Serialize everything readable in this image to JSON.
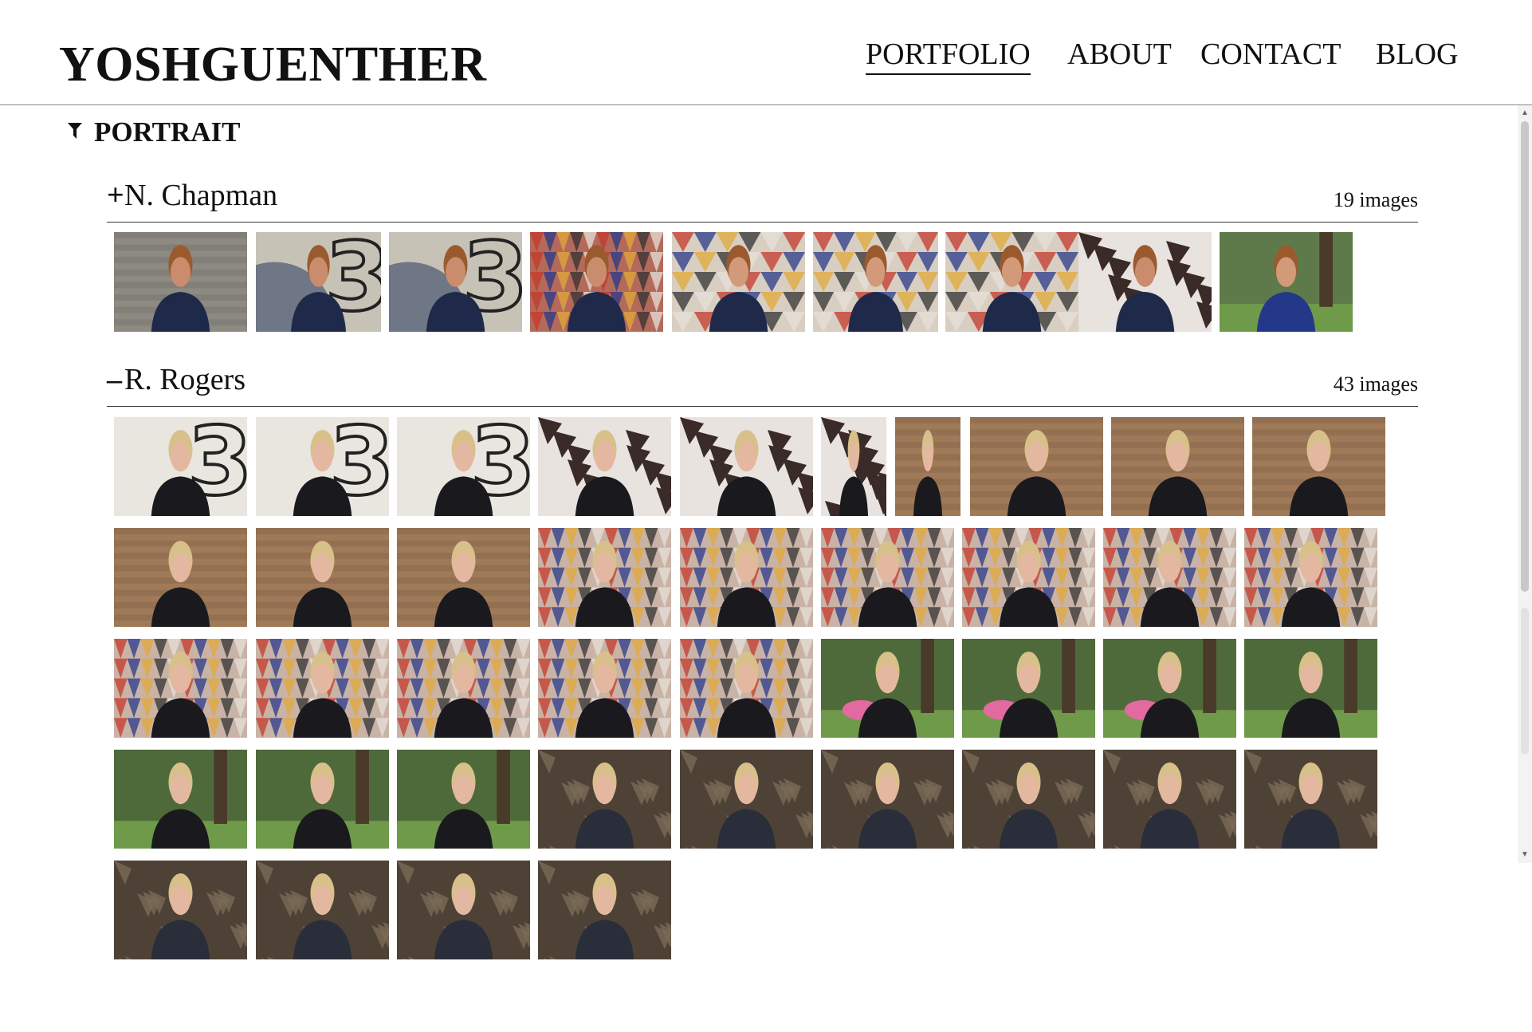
{
  "site": {
    "logo": "YOSHGUENTHER"
  },
  "nav": [
    {
      "label": "PORTFOLIO",
      "active": true
    },
    {
      "label": "ABOUT",
      "active": false
    },
    {
      "label": "CONTACT",
      "active": false
    },
    {
      "label": "BLOG",
      "active": false
    }
  ],
  "category": {
    "label": "PORTRAIT",
    "icon": "funnel-icon"
  },
  "albums": [
    {
      "toggle": "+",
      "name": "N. Chapman",
      "count": "19 images",
      "thumbs": [
        {
          "bg": "#8d8a82",
          "fig": "#1f2a4a",
          "skin": "#c98d6e",
          "hair": "#9a5a2e",
          "pat": "wood"
        },
        {
          "bg": "#c7c2b6",
          "fig": "#1f2a4a",
          "skin": "#c98d6e",
          "hair": "#9a5a2e",
          "pat": "num"
        },
        {
          "bg": "#c7c2b6",
          "fig": "#1f2a4a",
          "skin": "#c98d6e",
          "hair": "#9a5a2e",
          "pat": "num"
        },
        {
          "bg": "#b46a5a",
          "fig": "#1f2a4a",
          "skin": "#c98d6e",
          "hair": "#9a5a2e",
          "pat": "tri"
        },
        {
          "bg": "#d8cfc2",
          "fig": "#1f2a4a",
          "skin": "#d29a78",
          "hair": "#9a5a2e",
          "pat": "tri2"
        },
        {
          "bg": "#d8cfc2",
          "fig": "#1f2a4a",
          "skin": "#d29a78",
          "hair": "#9a5a2e",
          "pat": "tri2"
        },
        {
          "bg": "#d8cfc2",
          "fig": "#1f2a4a",
          "skin": "#d29a78",
          "hair": "#9a5a2e",
          "pat": "tri2"
        },
        {
          "bg": "#e8e3de",
          "fig": "#1f2a4a",
          "skin": "#c98d6e",
          "hair": "#9a5a2e",
          "pat": "geo"
        },
        {
          "bg": "#5f7a4a",
          "fig": "#24388a",
          "skin": "#d29a78",
          "hair": "#9a5a2e",
          "pat": "park"
        }
      ]
    },
    {
      "toggle": "–",
      "name": "R. Rogers",
      "count": "43 images",
      "thumbs": [
        {
          "bg": "#e9e6e0",
          "fig": "#1a1a1e",
          "skin": "#e4b8a0",
          "hair": "#d8c08a",
          "pat": "num3"
        },
        {
          "bg": "#e9e6e0",
          "fig": "#1a1a1e",
          "skin": "#e4b8a0",
          "hair": "#d8c08a",
          "pat": "num3"
        },
        {
          "bg": "#e9e6e0",
          "fig": "#1a1a1e",
          "skin": "#e4b8a0",
          "hair": "#d8c08a",
          "pat": "num3"
        },
        {
          "bg": "#e8e3de",
          "fig": "#1a1a1e",
          "skin": "#e4b8a0",
          "hair": "#d8c08a",
          "pat": "geo"
        },
        {
          "bg": "#e8e3de",
          "fig": "#1a1a1e",
          "skin": "#e4b8a0",
          "hair": "#d8c08a",
          "pat": "geo"
        },
        {
          "bg": "#e8e3de",
          "fig": "#1a1a1e",
          "skin": "#e4b8a0",
          "hair": "#d8c08a",
          "pat": "geo"
        },
        {
          "bg": "#a07a58",
          "fig": "#1a1a1e",
          "skin": "#e4b8a0",
          "hair": "#d8c08a",
          "pat": "wood"
        },
        {
          "bg": "#a07a58",
          "fig": "#1a1a1e",
          "skin": "#e4b8a0",
          "hair": "#d8c08a",
          "pat": "wood"
        },
        {
          "bg": "#a07a58",
          "fig": "#1a1a1e",
          "skin": "#e4b8a0",
          "hair": "#d8c08a",
          "pat": "wood"
        },
        {
          "bg": "#a07a58",
          "fig": "#1a1a1e",
          "skin": "#e4b8a0",
          "hair": "#d8c08a",
          "pat": "wood"
        },
        {
          "bg": "#a07a58",
          "fig": "#1a1a1e",
          "skin": "#e4b8a0",
          "hair": "#d8c08a",
          "pat": "wood"
        },
        {
          "bg": "#a07a58",
          "fig": "#1a1a1e",
          "skin": "#e4b8a0",
          "hair": "#d8c08a",
          "pat": "wood"
        },
        {
          "bg": "#a07a58",
          "fig": "#1a1a1e",
          "skin": "#e4b8a0",
          "hair": "#d8c08a",
          "pat": "wood"
        },
        {
          "bg": "#c9b3a6",
          "fig": "#1a1a1e",
          "skin": "#e4b8a0",
          "hair": "#d8c08a",
          "pat": "tri"
        },
        {
          "bg": "#c9b3a6",
          "fig": "#1a1a1e",
          "skin": "#e4b8a0",
          "hair": "#d8c08a",
          "pat": "tri"
        },
        {
          "bg": "#c9b3a6",
          "fig": "#1a1a1e",
          "skin": "#e4b8a0",
          "hair": "#d8c08a",
          "pat": "tri"
        },
        {
          "bg": "#c9b3a6",
          "fig": "#1a1a1e",
          "skin": "#e4b8a0",
          "hair": "#d8c08a",
          "pat": "tri"
        },
        {
          "bg": "#c9b3a6",
          "fig": "#1a1a1e",
          "skin": "#e4b8a0",
          "hair": "#d8c08a",
          "pat": "tri"
        },
        {
          "bg": "#c9b3a6",
          "fig": "#1a1a1e",
          "skin": "#e4b8a0",
          "hair": "#d8c08a",
          "pat": "tri"
        },
        {
          "bg": "#c9b3a6",
          "fig": "#1a1a1e",
          "skin": "#e4b8a0",
          "hair": "#d8c08a",
          "pat": "tri"
        },
        {
          "bg": "#c9b3a6",
          "fig": "#1a1a1e",
          "skin": "#e4b8a0",
          "hair": "#d8c08a",
          "pat": "tri"
        },
        {
          "bg": "#c9b3a6",
          "fig": "#1a1a1e",
          "skin": "#e4b8a0",
          "hair": "#d8c08a",
          "pat": "tri"
        },
        {
          "bg": "#c9b3a6",
          "fig": "#1a1a1e",
          "skin": "#e4b8a0",
          "hair": "#d8c08a",
          "pat": "tri"
        },
        {
          "bg": "#c9b3a6",
          "fig": "#1a1a1e",
          "skin": "#e4b8a0",
          "hair": "#d8c08a",
          "pat": "tri"
        },
        {
          "bg": "#4f6a3a",
          "fig": "#1a1a1e",
          "skin": "#e4b8a0",
          "hair": "#d8c08a",
          "pat": "flamingo"
        },
        {
          "bg": "#4f6a3a",
          "fig": "#1a1a1e",
          "skin": "#e4b8a0",
          "hair": "#d8c08a",
          "pat": "flamingo"
        },
        {
          "bg": "#4f6a3a",
          "fig": "#1a1a1e",
          "skin": "#e4b8a0",
          "hair": "#d8c08a",
          "pat": "flamingo"
        },
        {
          "bg": "#4f6a3a",
          "fig": "#1a1a1e",
          "skin": "#e4b8a0",
          "hair": "#d8c08a",
          "pat": "park"
        },
        {
          "bg": "#4f6a3a",
          "fig": "#1a1a1e",
          "skin": "#e4b8a0",
          "hair": "#d8c08a",
          "pat": "park"
        },
        {
          "bg": "#4f6a3a",
          "fig": "#1a1a1e",
          "skin": "#e4b8a0",
          "hair": "#d8c08a",
          "pat": "park"
        },
        {
          "bg": "#4f6a3a",
          "fig": "#1a1a1e",
          "skin": "#e4b8a0",
          "hair": "#d8c08a",
          "pat": "park"
        },
        {
          "bg": "#4e4236",
          "fig": "#2a2d3a",
          "skin": "#e4b8a0",
          "hair": "#d8c08a",
          "pat": "palm"
        },
        {
          "bg": "#4e4236",
          "fig": "#2a2d3a",
          "skin": "#e4b8a0",
          "hair": "#d8c08a",
          "pat": "palm"
        },
        {
          "bg": "#4e4236",
          "fig": "#2a2d3a",
          "skin": "#e4b8a0",
          "hair": "#d8c08a",
          "pat": "palm"
        },
        {
          "bg": "#4e4236",
          "fig": "#2a2d3a",
          "skin": "#e4b8a0",
          "hair": "#d8c08a",
          "pat": "palm"
        },
        {
          "bg": "#4e4236",
          "fig": "#2a2d3a",
          "skin": "#e4b8a0",
          "hair": "#d8c08a",
          "pat": "palm"
        },
        {
          "bg": "#4e4236",
          "fig": "#2a2d3a",
          "skin": "#e4b8a0",
          "hair": "#d8c08a",
          "pat": "palm"
        },
        {
          "bg": "#4e4236",
          "fig": "#2a2d3a",
          "skin": "#e4b8a0",
          "hair": "#d8c08a",
          "pat": "palm"
        },
        {
          "bg": "#4e4236",
          "fig": "#2a2d3a",
          "skin": "#e4b8a0",
          "hair": "#d8c08a",
          "pat": "palm"
        },
        {
          "bg": "#4e4236",
          "fig": "#2a2d3a",
          "skin": "#e4b8a0",
          "hair": "#d8c08a",
          "pat": "palm"
        },
        {
          "bg": "#4e4236",
          "fig": "#2a2d3a",
          "skin": "#e4b8a0",
          "hair": "#d8c08a",
          "pat": "palm"
        }
      ]
    }
  ],
  "scrollbar": {
    "up_icon": "▲",
    "down_icon": "▼"
  }
}
